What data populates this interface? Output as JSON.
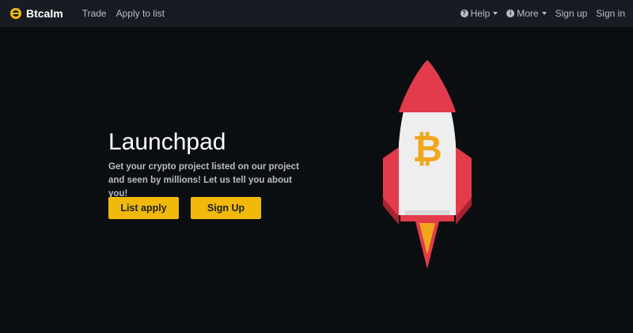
{
  "navbar": {
    "brand": "Btcalm",
    "links": [
      "Trade",
      "Apply to list"
    ],
    "help_label": "Help",
    "more_label": "More",
    "signup_label": "Sign up",
    "signin_label": "Sign in"
  },
  "hero": {
    "title": "Launchpad",
    "description": "Get your crypto project listed on our project and seen by millions! Let us tell you about you!",
    "list_apply_label": "List apply",
    "sign_up_label": "Sign Up"
  },
  "colors": {
    "background": "#0b0e11",
    "navbar": "#181c22",
    "accent": "#f0b90b",
    "rocket_red": "#e23b4b",
    "rocket_body": "#eeeeee"
  },
  "icons": {
    "brand": "logo-icon",
    "help": "question-circle-icon",
    "more": "info-circle-icon",
    "illustration": "bitcoin-rocket"
  }
}
